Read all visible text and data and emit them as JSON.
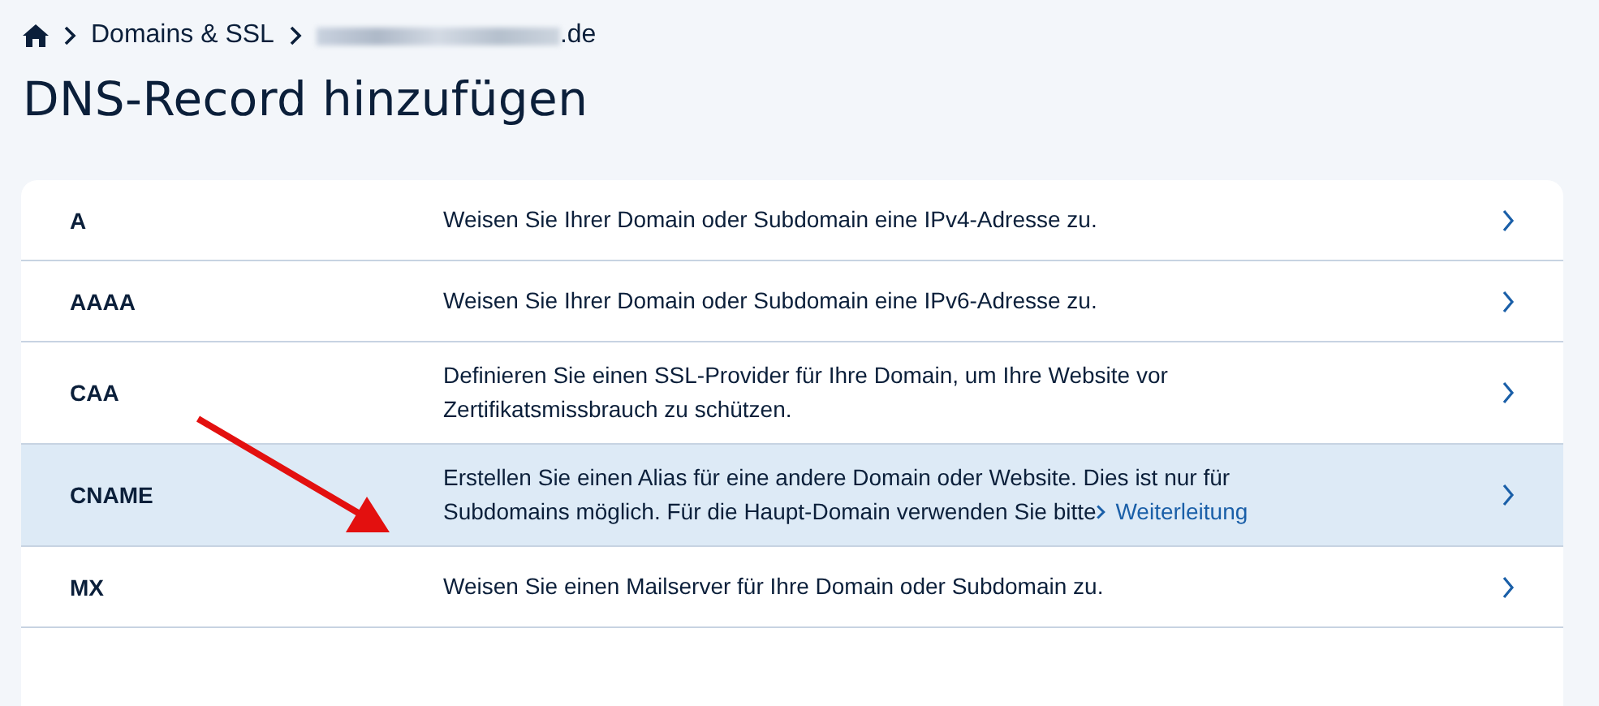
{
  "breadcrumb": [
    {
      "label": "Domains & SSL",
      "masked_prefix": false
    },
    {
      "label": ".de",
      "masked_prefix": true
    }
  ],
  "title": "DNS-Record hinzufügen",
  "records": [
    {
      "type": "A",
      "description": "Weisen Sie Ihrer Domain oder Subdomain eine IPv4-Adresse zu.",
      "selected": false
    },
    {
      "type": "AAAA",
      "description": "Weisen Sie Ihrer Domain oder Subdomain eine IPv6-Adresse zu.",
      "selected": false
    },
    {
      "type": "CAA",
      "description": "Definieren Sie einen SSL-Provider für Ihre Domain, um Ihre Website vor Zertifikatsmissbrauch zu schützen.",
      "selected": false
    },
    {
      "type": "CNAME",
      "description": "Erstellen Sie einen Alias für eine andere Domain oder Website. Dies ist nur für Subdomains möglich. Für die Haupt-Domain verwenden Sie bitte",
      "link": "Weiterleitung",
      "selected": true
    },
    {
      "type": "MX",
      "description": "Weisen Sie einen Mailserver für Ihre Domain oder Subdomain zu.",
      "selected": false
    }
  ],
  "annotation": {
    "kind": "arrow"
  }
}
